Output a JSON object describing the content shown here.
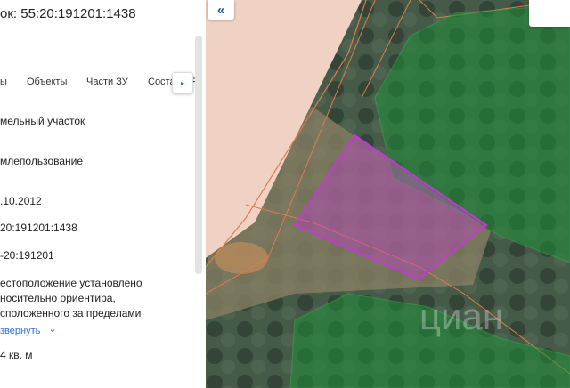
{
  "panel": {
    "title": "ок: 55:20:191201:1438",
    "tabs": [
      "ы",
      "Объекты",
      "Части ЗУ",
      "Соста",
      "Я"
    ],
    "fields": [
      "мельный участок",
      "млепользование",
      ".10.2012",
      "20:191201:1438",
      "-20:191201"
    ],
    "location_lines": [
      "естоположение установлено",
      "носительно ориентира,",
      "сположенного за пределами"
    ],
    "collapse_link": "звернуть",
    "area": "4 кв. м"
  },
  "map": {
    "parcel_color": "#c23bd0",
    "boundary_color": "#e07a52",
    "forest_color": "#1f8f3a",
    "watermark": "циан"
  },
  "icons": {
    "collapse": "«",
    "next": "▸",
    "chevron": "⌄"
  }
}
